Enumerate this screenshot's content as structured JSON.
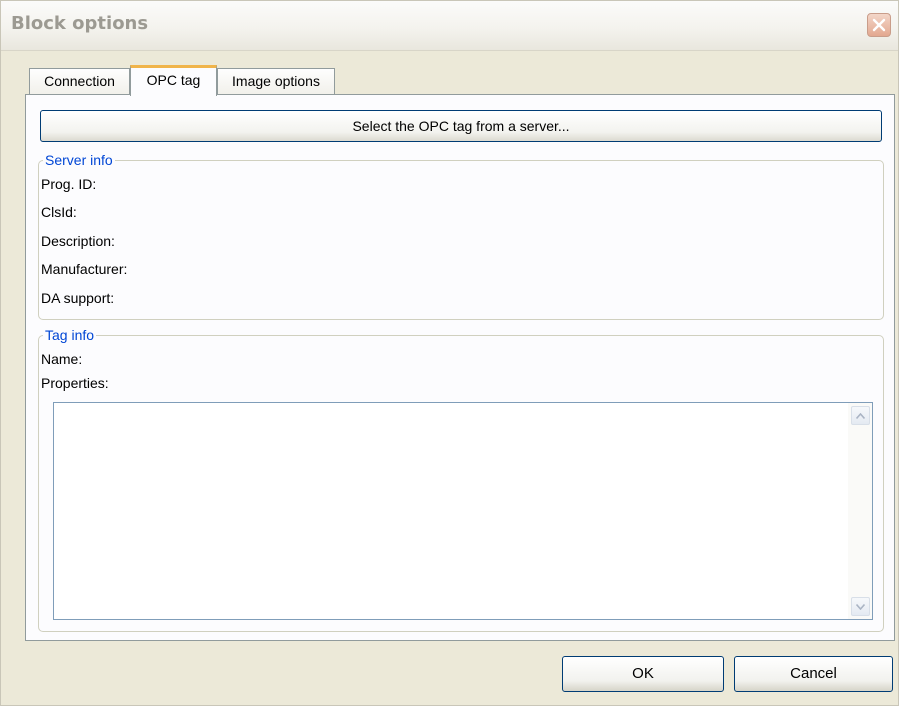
{
  "window": {
    "title": "Block options"
  },
  "tabs": [
    {
      "label": "Connection"
    },
    {
      "label": "OPC tag"
    },
    {
      "label": "Image options"
    }
  ],
  "opc_tag": {
    "select_button_label": "Select the OPC tag from a server...",
    "server_info": {
      "title": "Server info",
      "fields": [
        {
          "label": "Prog. ID:"
        },
        {
          "label": "ClsId:"
        },
        {
          "label": "Description:"
        },
        {
          "label": "Manufacturer:"
        },
        {
          "label": "DA support:"
        }
      ]
    },
    "tag_info": {
      "title": "Tag info",
      "name_label": "Name:",
      "properties_label": "Properties:"
    }
  },
  "buttons": {
    "ok": "OK",
    "cancel": "Cancel"
  },
  "colors": {
    "active_tab_accent": "#f0b44a",
    "group_title": "#0046d5",
    "button_border": "#003c74"
  },
  "icons": {
    "close": "close-icon",
    "scroll_up": "scroll-up-arrow-icon",
    "scroll_down": "scroll-down-arrow-icon"
  }
}
